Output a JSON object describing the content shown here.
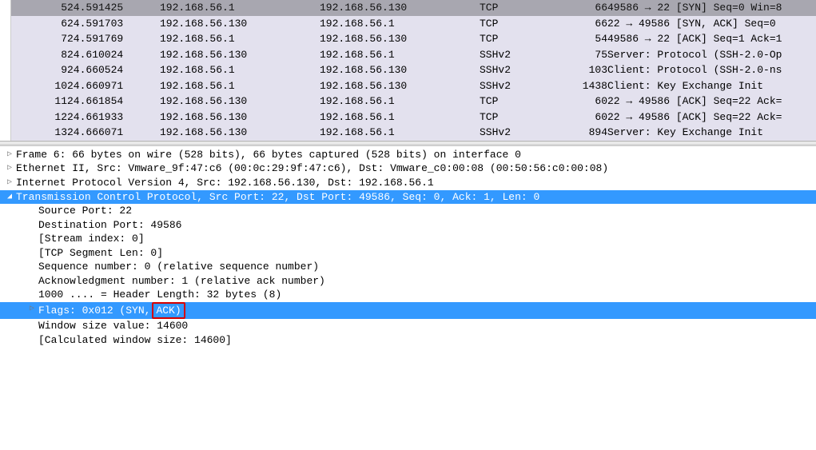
{
  "packets": [
    {
      "no": "5",
      "time": "24.591425",
      "src": "192.168.56.1",
      "dst": "192.168.56.130",
      "proto": "TCP",
      "len": "66",
      "info": "49586 → 22 [SYN] Seq=0 Win=8",
      "dark": true
    },
    {
      "no": "6",
      "time": "24.591703",
      "src": "192.168.56.130",
      "dst": "192.168.56.1",
      "proto": "TCP",
      "len": "66",
      "info": "22 → 49586 [SYN, ACK] Seq=0"
    },
    {
      "no": "7",
      "time": "24.591769",
      "src": "192.168.56.1",
      "dst": "192.168.56.130",
      "proto": "TCP",
      "len": "54",
      "info": "49586 → 22 [ACK] Seq=1 Ack=1"
    },
    {
      "no": "8",
      "time": "24.610024",
      "src": "192.168.56.130",
      "dst": "192.168.56.1",
      "proto": "SSHv2",
      "len": "75",
      "info": "Server: Protocol (SSH-2.0-Op"
    },
    {
      "no": "9",
      "time": "24.660524",
      "src": "192.168.56.1",
      "dst": "192.168.56.130",
      "proto": "SSHv2",
      "len": "103",
      "info": "Client: Protocol (SSH-2.0-ns"
    },
    {
      "no": "10",
      "time": "24.660971",
      "src": "192.168.56.1",
      "dst": "192.168.56.130",
      "proto": "SSHv2",
      "len": "1438",
      "info": "Client: Key Exchange Init"
    },
    {
      "no": "11",
      "time": "24.661854",
      "src": "192.168.56.130",
      "dst": "192.168.56.1",
      "proto": "TCP",
      "len": "60",
      "info": "22 → 49586 [ACK] Seq=22 Ack="
    },
    {
      "no": "12",
      "time": "24.661933",
      "src": "192.168.56.130",
      "dst": "192.168.56.1",
      "proto": "TCP",
      "len": "60",
      "info": "22 → 49586 [ACK] Seq=22 Ack="
    },
    {
      "no": "13",
      "time": "24.666071",
      "src": "192.168.56.130",
      "dst": "192.168.56.1",
      "proto": "SSHv2",
      "len": "894",
      "info": "Server: Key Exchange Init"
    }
  ],
  "details": {
    "frame": "Frame 6: 66 bytes on wire (528 bits), 66 bytes captured (528 bits) on interface 0",
    "ethernet": "Ethernet II, Src: Vmware_9f:47:c6 (00:0c:29:9f:47:c6), Dst: Vmware_c0:00:08 (00:50:56:c0:00:08)",
    "ip": "Internet Protocol Version 4, Src: 192.168.56.130, Dst: 192.168.56.1",
    "tcp": "Transmission Control Protocol, Src Port: 22, Dst Port: 49586, Seq: 0, Ack: 1, Len: 0",
    "srcport": "Source Port: 22",
    "dstport": "Destination Port: 49586",
    "stream": "[Stream index: 0]",
    "seglen": "[TCP Segment Len: 0]",
    "seq": "Sequence number: 0    (relative sequence number)",
    "ack": "Acknowledgment number: 1    (relative ack number)",
    "hdrlen": "1000 .... = Header Length: 32 bytes (8)",
    "flags_pre": "Flags: 0x012 (SYN,",
    "flags_box": "ACK)",
    "win": "Window size value: 14600",
    "calcwin": "[Calculated window size: 14600]"
  },
  "glyphs": {
    "tri_right": "▷",
    "tri_down": "◢"
  }
}
